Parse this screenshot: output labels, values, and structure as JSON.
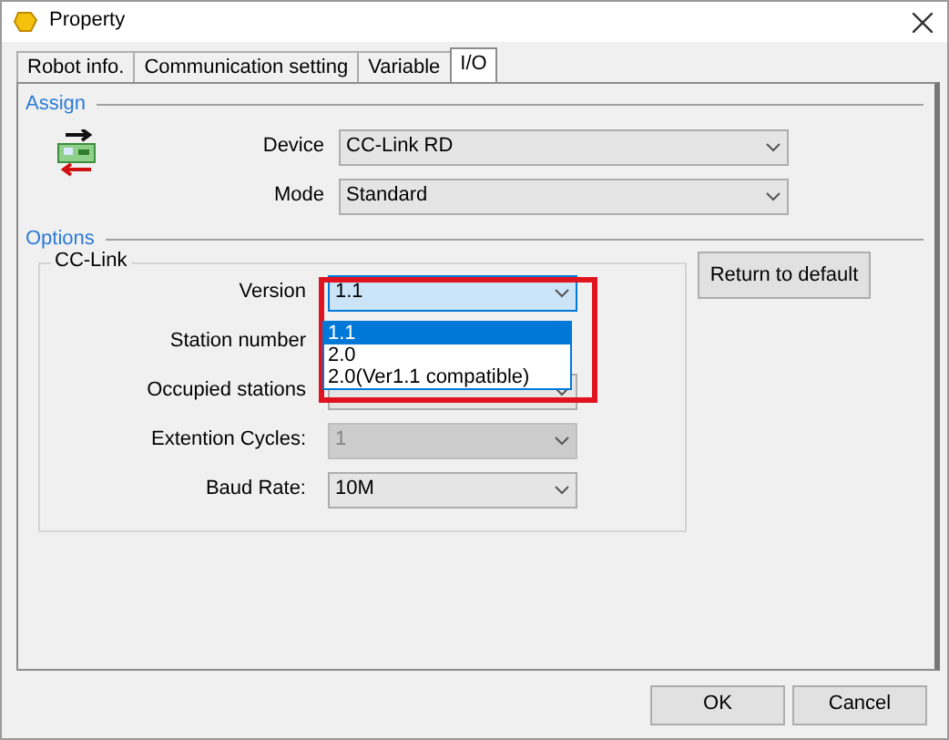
{
  "window": {
    "title": "Property"
  },
  "tabs": [
    {
      "label": "Robot info.",
      "selected": false
    },
    {
      "label": "Communication setting",
      "selected": false
    },
    {
      "label": "Variable",
      "selected": false
    },
    {
      "label": "I/O",
      "selected": true
    }
  ],
  "assign": {
    "legend": "Assign",
    "fields": [
      {
        "label": "Device",
        "value": "CC-Link RD"
      },
      {
        "label": "Mode",
        "value": "Standard"
      }
    ]
  },
  "options": {
    "legend": "Options",
    "group": "CC-Link",
    "fields": [
      {
        "kind": "combo",
        "label": "Version",
        "value": "1.1",
        "disabled": false,
        "open": true
      },
      {
        "kind": "label",
        "label": "Station number"
      },
      {
        "kind": "combo",
        "label": "Occupied stations",
        "disabled": false,
        "open": false
      },
      {
        "kind": "combo",
        "label": "Extention Cycles:",
        "value": "1",
        "disabled": true,
        "open": false
      },
      {
        "kind": "combo",
        "label": "Baud Rate:",
        "value": "10M",
        "disabled": false,
        "open": false
      }
    ],
    "dropdown": [
      {
        "label": "1.1",
        "selected": true
      },
      {
        "label": "2.0",
        "selected": false
      },
      {
        "label": "2.0(Ver1.1 compatible)",
        "selected": false
      }
    ],
    "reset_button": "Return to default"
  },
  "buttons": [
    "OK",
    "Cancel"
  ]
}
